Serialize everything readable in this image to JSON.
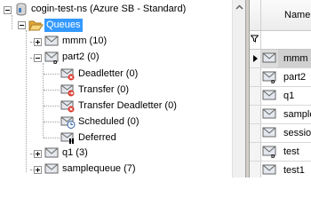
{
  "tree": {
    "namespace": "cogin-test-ns (Azure SB - Standard)",
    "queues_folder": "Queues",
    "queues": [
      {
        "label": "mmm (10)",
        "expanded": false
      },
      {
        "label": "part2 (0)",
        "expanded": true,
        "children": [
          "Deadletter (0)",
          "Transfer (0)",
          "Transfer Deadletter (0)",
          "Scheduled (0)",
          "Deferred"
        ]
      },
      {
        "label": "q1 (3)",
        "expanded": false
      },
      {
        "label": "samplequeue (7)",
        "expanded": false
      }
    ]
  },
  "grid": {
    "column_header": "Name",
    "rows": [
      "mmm",
      "part2",
      "q1",
      "sample",
      "session",
      "test",
      "test1"
    ]
  },
  "colors": {
    "selection": "#3399ff",
    "folder": "#f2c14e",
    "envelope": "#d9dde3"
  }
}
